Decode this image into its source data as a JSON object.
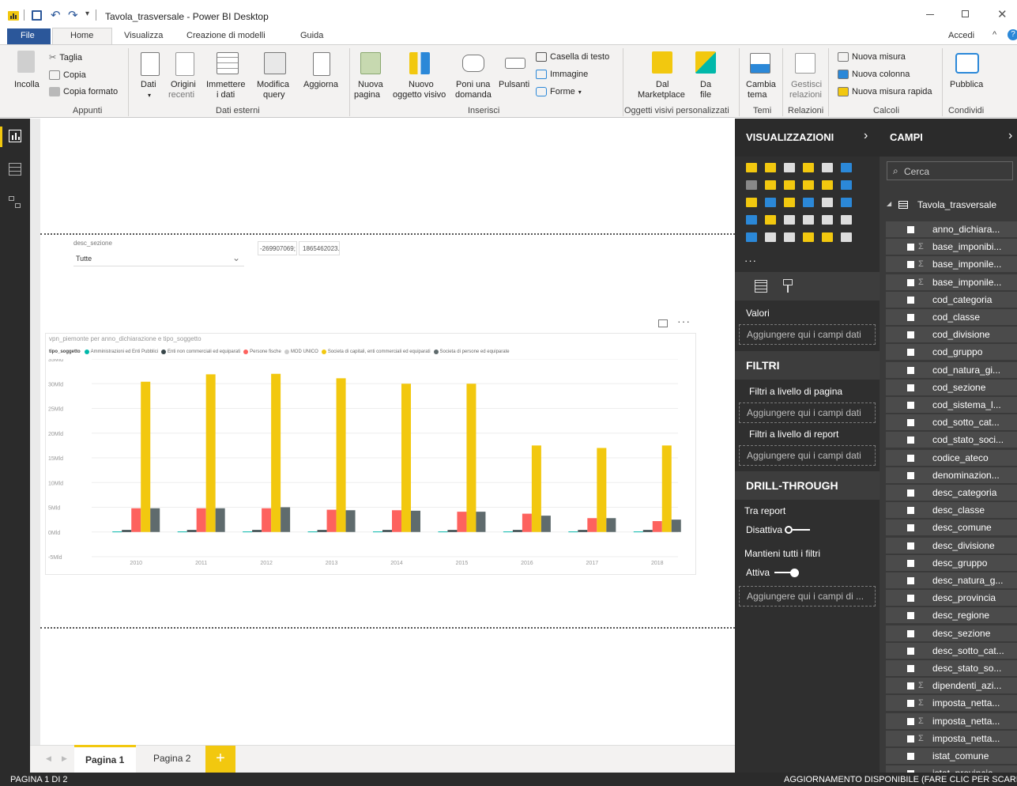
{
  "app": {
    "title": "Tavola_trasversale - Power BI Desktop",
    "signin": "Accedi"
  },
  "menu_tabs": [
    "File",
    "Home",
    "Visualizza",
    "Creazione di modelli",
    "Guida"
  ],
  "ribbon": {
    "incolla": "Incolla",
    "taglia": "Taglia",
    "copia": "Copia",
    "copia_formato": "Copia formato",
    "dati": "Dati",
    "origini": "Origini",
    "recenti": "recenti",
    "immettere": "Immettere",
    "i_dati": "i dati",
    "modifica": "Modifica",
    "query": "query",
    "aggiorna": "Aggiorna",
    "nuova": "Nuova",
    "pagina": "pagina",
    "nuovo": "Nuovo",
    "oggetto_visivo": "oggetto visivo",
    "poni_una": "Poni una",
    "domanda": "domanda",
    "pulsanti": "Pulsanti",
    "casella_testo": "Casella di testo",
    "immagine": "Immagine",
    "forme": "Forme",
    "dal": "Dal",
    "marketplace": "Marketplace",
    "da": "Da",
    "file": "file",
    "cambia": "Cambia",
    "tema": "tema",
    "gestisci": "Gestisci",
    "relazioni": "relazioni",
    "nuova_misura": "Nuova misura",
    "nuova_colonna": "Nuova colonna",
    "nuova_misura_rapida": "Nuova misura rapida",
    "pubblica": "Pubblica",
    "groups": {
      "appunti": "Appunti",
      "dati_esterni": "Dati esterni",
      "inserisci": "Inserisci",
      "oggetti_visivi": "Oggetti visivi personalizzati",
      "temi": "Temi",
      "relazioni": "Relazioni",
      "calcoli": "Calcoli",
      "condividi": "Condividi"
    }
  },
  "slicer": {
    "label": "desc_sezione",
    "value": "Tutte"
  },
  "cards": [
    "-269907069;",
    "1865462023."
  ],
  "chart_data": {
    "type": "bar",
    "title": "vpn_piemonte per anno_dichiarazione e tipo_soggetto",
    "legend_title": "tipo_soggetto",
    "categories": [
      "2010",
      "2011",
      "2012",
      "2013",
      "2014",
      "2015",
      "2016",
      "2017",
      "2018"
    ],
    "y_ticks": [
      "35Mld",
      "30Mld",
      "25Mld",
      "20Mld",
      "15Mld",
      "10Mld",
      "5Mld",
      "0Mld",
      "-5Mld"
    ],
    "ylim": [
      -5,
      35
    ],
    "unit": "Mld",
    "series": [
      {
        "name": "Amministrazioni ed Enti Pubblici",
        "color": "#01b8aa",
        "values": [
          0.1,
          0.1,
          0.1,
          0.1,
          0.1,
          0.1,
          0.1,
          0.1,
          0.1
        ]
      },
      {
        "name": "Enti non commerciali ed equiparati",
        "color": "#374649",
        "values": [
          0.4,
          0.4,
          0.4,
          0.4,
          0.4,
          0.4,
          0.4,
          0.4,
          0.4
        ]
      },
      {
        "name": "Persone fische",
        "color": "#fd625e",
        "values": [
          4.8,
          4.8,
          4.8,
          4.5,
          4.4,
          4.1,
          3.7,
          2.8,
          2.2
        ]
      },
      {
        "name": "MOD UNICO",
        "color": "#cccccc",
        "values": [
          0,
          0,
          0,
          0,
          0,
          0,
          0,
          0,
          0
        ]
      },
      {
        "name": "Societa di capitali, enti commerciali ed equiparati",
        "color": "#f2c80f",
        "values": [
          30.4,
          31.9,
          32.0,
          31.1,
          30.0,
          30.0,
          17.5,
          17.0,
          17.5
        ]
      },
      {
        "name": "Societa di persone ed equiparate",
        "color": "#5f6b6d",
        "values": [
          4.8,
          4.8,
          5.0,
          4.4,
          4.3,
          4.1,
          3.3,
          2.8,
          2.5
        ]
      }
    ]
  },
  "page_tabs": [
    "Pagina 1",
    "Pagina 2"
  ],
  "visualizzazioni": {
    "title": "VISUALIZZAZIONI",
    "valori": "Valori",
    "drop": "Aggiungere qui i campi dati",
    "filtri": "FILTRI",
    "filtri_pagina": "Filtri a livello di pagina",
    "filtri_report": "Filtri a livello di report",
    "drill": "DRILL-THROUGH",
    "tra_report": "Tra report",
    "disattiva": "Disattiva",
    "mantieni": "Mantieni tutti i filtri",
    "attiva": "Attiva",
    "drop_drill": "Aggiungere qui i campi di ..."
  },
  "campi": {
    "title": "CAMPI",
    "search_placeholder": "Cerca",
    "table": "Tavola_trasversale",
    "fields": [
      {
        "name": "anno_dichiara...",
        "sigma": false
      },
      {
        "name": "base_imponibi...",
        "sigma": true
      },
      {
        "name": "base_imponile...",
        "sigma": true
      },
      {
        "name": "base_imponile...",
        "sigma": true
      },
      {
        "name": "cod_categoria",
        "sigma": false
      },
      {
        "name": "cod_classe",
        "sigma": false
      },
      {
        "name": "cod_divisione",
        "sigma": false
      },
      {
        "name": "cod_gruppo",
        "sigma": false
      },
      {
        "name": "cod_natura_gi...",
        "sigma": false
      },
      {
        "name": "cod_sezione",
        "sigma": false
      },
      {
        "name": "cod_sistema_l...",
        "sigma": false
      },
      {
        "name": "cod_sotto_cat...",
        "sigma": false
      },
      {
        "name": "cod_stato_soci...",
        "sigma": false
      },
      {
        "name": "codice_ateco",
        "sigma": false
      },
      {
        "name": "denominazion...",
        "sigma": false
      },
      {
        "name": "desc_categoria",
        "sigma": false
      },
      {
        "name": "desc_classe",
        "sigma": false
      },
      {
        "name": "desc_comune",
        "sigma": false
      },
      {
        "name": "desc_divisione",
        "sigma": false
      },
      {
        "name": "desc_gruppo",
        "sigma": false
      },
      {
        "name": "desc_natura_g...",
        "sigma": false
      },
      {
        "name": "desc_provincia",
        "sigma": false
      },
      {
        "name": "desc_regione",
        "sigma": false
      },
      {
        "name": "desc_sezione",
        "sigma": false
      },
      {
        "name": "desc_sotto_cat...",
        "sigma": false
      },
      {
        "name": "desc_stato_so...",
        "sigma": false
      },
      {
        "name": "dipendenti_azi...",
        "sigma": true
      },
      {
        "name": "imposta_netta...",
        "sigma": true
      },
      {
        "name": "imposta_netta...",
        "sigma": true
      },
      {
        "name": "imposta_netta...",
        "sigma": true
      },
      {
        "name": "istat_comune",
        "sigma": false
      },
      {
        "name": "istat_provincia",
        "sigma": false
      }
    ]
  },
  "status": {
    "page": "PAGINA 1 DI 2",
    "update": "AGGIORNAMENTO DISPONIBILE (FARE CLIC PER SCARICARE"
  }
}
